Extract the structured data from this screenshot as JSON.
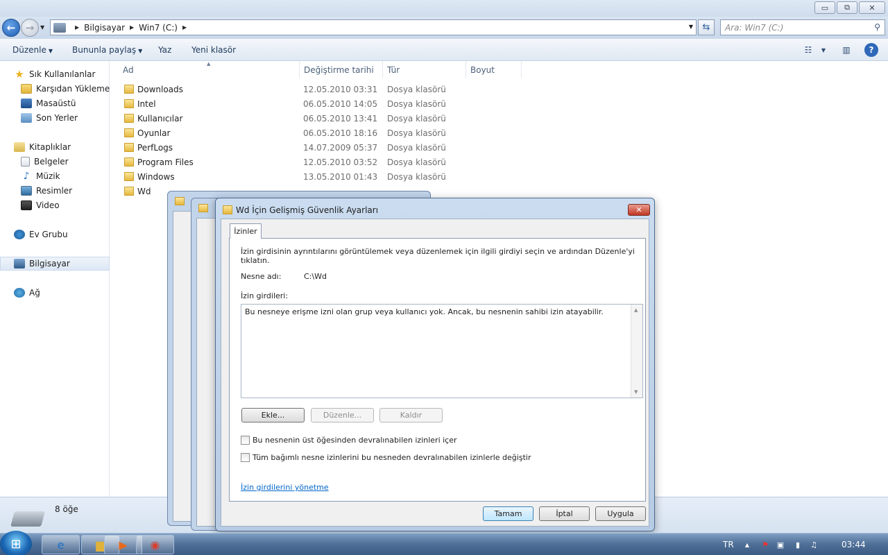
{
  "window": {
    "minimize": "▭",
    "maximize": "⧉",
    "close": "✕"
  },
  "address": {
    "crumbs": [
      "Bilgisayar",
      "Win7 (C:)"
    ],
    "search_placeholder": "Ara: Win7 (C:)"
  },
  "toolbar": {
    "organize": "Düzenle",
    "share": "Bununla paylaş",
    "burn": "Yaz",
    "new_folder": "Yeni klasör"
  },
  "sidebar": {
    "favorites": "Sık Kullanılanlar",
    "downloads": "Karşıdan Yüklemeler",
    "desktop": "Masaüstü",
    "recent": "Son Yerler",
    "libraries": "Kitaplıklar",
    "documents": "Belgeler",
    "music": "Müzik",
    "pictures": "Resimler",
    "video": "Video",
    "homegroup": "Ev Grubu",
    "computer": "Bilgisayar",
    "network": "Ağ"
  },
  "columns": {
    "name": "Ad",
    "date": "Değiştirme tarihi",
    "type": "Tür",
    "size": "Boyut"
  },
  "files": [
    {
      "name": "Downloads",
      "date": "12.05.2010 03:31",
      "type": "Dosya klasörü"
    },
    {
      "name": "Intel",
      "date": "06.05.2010 14:05",
      "type": "Dosya klasörü"
    },
    {
      "name": "Kullanıcılar",
      "date": "06.05.2010 13:41",
      "type": "Dosya klasörü"
    },
    {
      "name": "Oyunlar",
      "date": "06.05.2010 18:16",
      "type": "Dosya klasörü"
    },
    {
      "name": "PerfLogs",
      "date": "14.07.2009 05:37",
      "type": "Dosya klasörü"
    },
    {
      "name": "Program Files",
      "date": "12.05.2010 03:52",
      "type": "Dosya klasörü"
    },
    {
      "name": "Windows",
      "date": "13.05.2010 01:43",
      "type": "Dosya klasörü"
    },
    {
      "name": "Wd",
      "date": "",
      "type": ""
    }
  ],
  "status": {
    "count": "8 öğe"
  },
  "dialog": {
    "title": "Wd İçin Gelişmiş Güvenlik Ayarları",
    "tab": "İzinler",
    "info": "İzin girdisinin ayrıntılarını görüntülemek veya düzenlemek için ilgili girdiyi seçin ve ardından Düzenle'yi tıklatın.",
    "object_label": "Nesne adı:",
    "object_value": "C:\\Wd",
    "entries_label": "İzin girdileri:",
    "entries_message": "Bu nesneye erişme izni olan grup veya kullanıcı yok. Ancak, bu nesnenin sahibi izin atayabilir.",
    "add": "Ekle...",
    "edit": "Düzenle...",
    "remove": "Kaldır",
    "inherit": "Bu nesnenin üst öğesinden devralınabilen izinleri içer",
    "replace": "Tüm bağımlı nesne izinlerini bu nesneden devralınabilen izinlerle değiştir",
    "manage_link": "İzin girdilerini yönetme",
    "ok": "Tamam",
    "cancel": "İptal",
    "apply": "Uygula"
  },
  "taskbar": {
    "lang": "TR",
    "clock": "03:44"
  }
}
